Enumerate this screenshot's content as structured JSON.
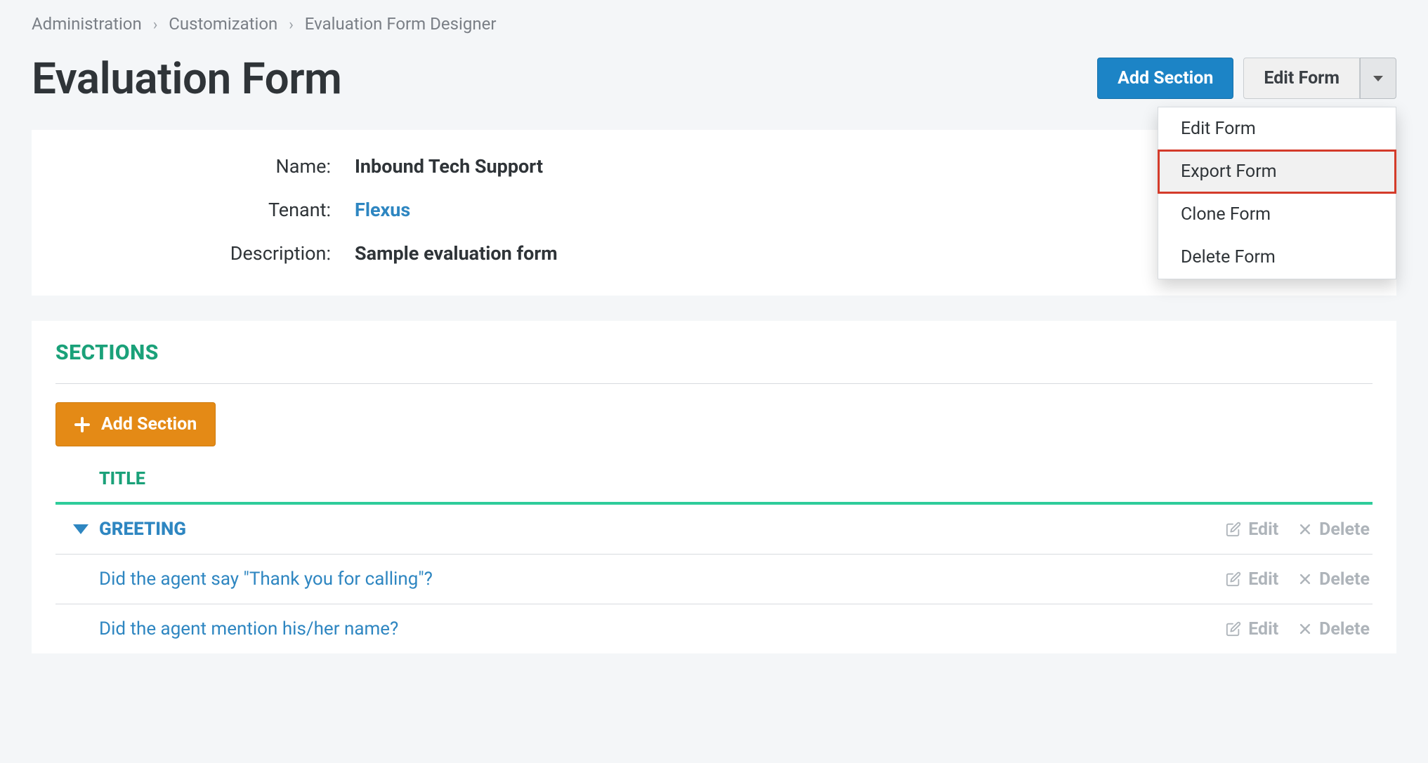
{
  "breadcrumbs": {
    "items": [
      "Administration",
      "Customization",
      "Evaluation Form Designer"
    ]
  },
  "page_title": "Evaluation Form",
  "header_actions": {
    "add_section": "Add Section",
    "edit_form": "Edit Form"
  },
  "dropdown": {
    "items": [
      "Edit Form",
      "Export Form",
      "Clone Form",
      "Delete Form"
    ],
    "highlight_index": 1
  },
  "details": {
    "name_label": "Name:",
    "name_value": "Inbound Tech Support",
    "tenant_label": "Tenant:",
    "tenant_value": "Flexus",
    "description_label": "Description:",
    "description_value": "Sample evaluation form"
  },
  "sections": {
    "heading": "SECTIONS",
    "add_button": "Add Section",
    "column_title": "TITLE",
    "edit_label": "Edit",
    "delete_label": "Delete",
    "section_name": "GREETING",
    "questions": [
      "Did the agent say \"Thank you for calling\"?",
      "Did the agent mention his/her name?"
    ]
  }
}
